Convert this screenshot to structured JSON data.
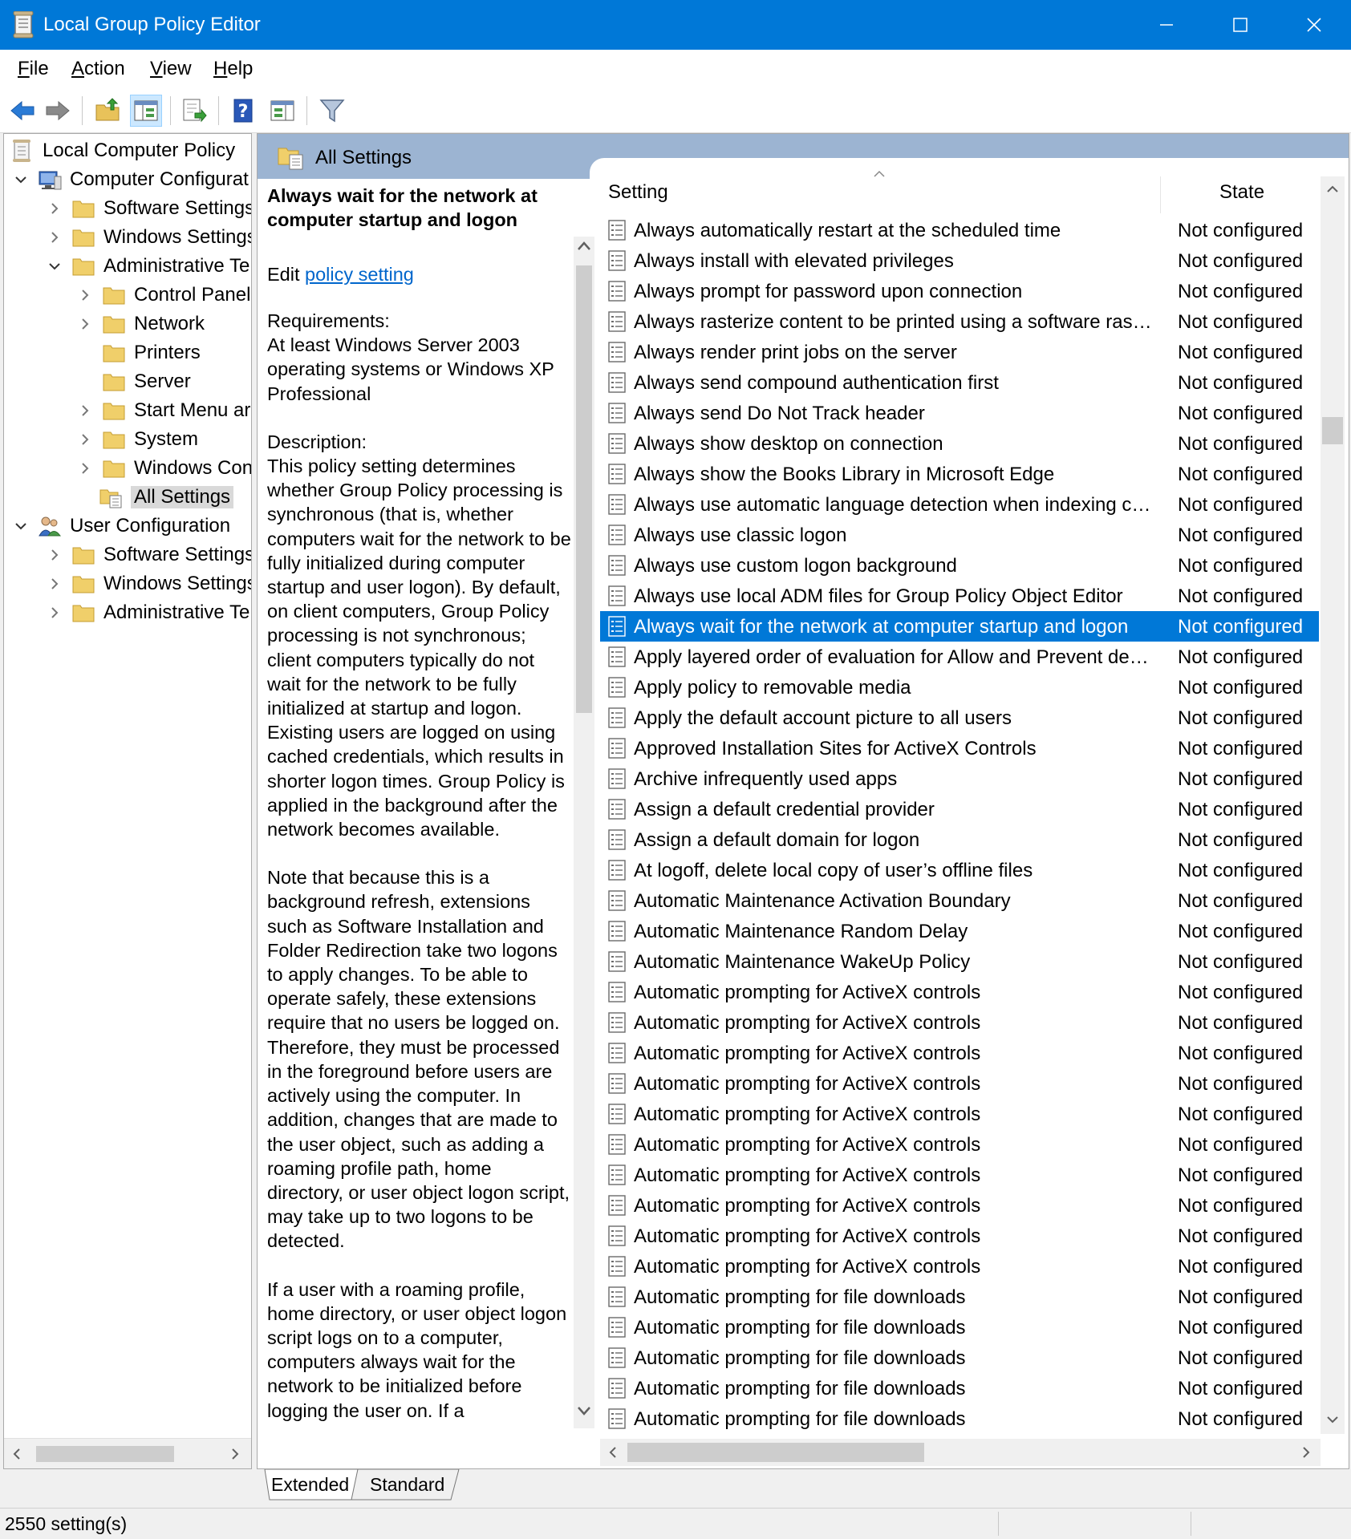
{
  "window": {
    "title": "Local Group Policy Editor"
  },
  "menu": {
    "file": {
      "u": "F",
      "rest": "ile"
    },
    "action": {
      "u": "A",
      "rest": "ction"
    },
    "view": {
      "u": "V",
      "rest": "iew"
    },
    "help": {
      "u": "H",
      "rest": "elp"
    }
  },
  "tree": {
    "root": "Local Computer Policy",
    "computer_configuration": "Computer Configurat",
    "cc_software_settings": "Software Settings",
    "cc_windows_settings": "Windows Settings",
    "cc_administrative_templates": "Administrative Te",
    "control_panel": "Control Panel",
    "network": "Network",
    "printers": "Printers",
    "server": "Server",
    "start_menu": "Start Menu ar",
    "system": "System",
    "windows_components": "Windows Con",
    "all_settings": "All Settings",
    "user_configuration": "User Configuration",
    "uc_software_settings": "Software Settings",
    "uc_windows_settings": "Windows Settings",
    "uc_administrative_templates": "Administrative Te"
  },
  "header": {
    "title": "All Settings"
  },
  "description": {
    "title": "Always wait for the network at computer startup and logon",
    "edit_prefix": "Edit ",
    "edit_link": "policy setting ",
    "requirements_label": "Requirements:",
    "requirements_text": "At least Windows Server 2003 operating systems or Windows XP Professional",
    "description_label": "Description:",
    "paragraph1": "This policy setting determines whether Group Policy processing is synchronous (that is, whether computers wait for the network to be fully initialized during computer startup and user logon). By default, on client computers, Group Policy processing is not synchronous; client computers typically do not wait for the network to be fully initialized at startup and logon. Existing users are logged on using cached credentials, which results in shorter logon times. Group Policy is applied in the background after the network becomes available.",
    "paragraph2": "Note that because this is a background refresh, extensions such as Software Installation and Folder Redirection take two logons to apply changes. To be able to operate safely, these extensions require that no users be logged on. Therefore, they must be processed in the foreground before users are actively using the computer. In addition, changes that are made to the user object, such as adding a roaming profile path, home directory, or user object logon script, may take up to two logons to be detected.",
    "paragraph3": "If a user with a roaming profile, home directory, or user object logon script logs on to a computer, computers always wait for the network to be initialized before logging the user on. If a"
  },
  "table": {
    "col_setting": "Setting",
    "col_state": "State",
    "rows": [
      {
        "name": "Always automatically restart at the scheduled time",
        "state": "Not configured"
      },
      {
        "name": "Always install with elevated privileges",
        "state": "Not configured"
      },
      {
        "name": "Always prompt for password upon connection",
        "state": "Not configured"
      },
      {
        "name": "Always rasterize content to be printed using a software rasteri...",
        "state": "Not configured"
      },
      {
        "name": "Always render print jobs on the server",
        "state": "Not configured"
      },
      {
        "name": "Always send compound authentication first",
        "state": "Not configured"
      },
      {
        "name": "Always send Do Not Track header",
        "state": "Not configured"
      },
      {
        "name": "Always show desktop on connection",
        "state": "Not configured"
      },
      {
        "name": "Always show the Books Library in Microsoft Edge",
        "state": "Not configured"
      },
      {
        "name": "Always use automatic language detection when indexing con...",
        "state": "Not configured"
      },
      {
        "name": "Always use classic logon",
        "state": "Not configured"
      },
      {
        "name": "Always use custom logon background",
        "state": "Not configured"
      },
      {
        "name": "Always use local ADM files for Group Policy Object Editor",
        "state": "Not configured"
      },
      {
        "name": "Always wait for the network at computer startup and logon",
        "state": "Not configured",
        "selected": true
      },
      {
        "name": "Apply layered order of evaluation for Allow and Prevent devic...",
        "state": "Not configured"
      },
      {
        "name": "Apply policy to removable media",
        "state": "Not configured"
      },
      {
        "name": "Apply the default account picture to all users",
        "state": "Not configured"
      },
      {
        "name": "Approved Installation Sites for ActiveX Controls",
        "state": "Not configured"
      },
      {
        "name": "Archive infrequently used apps",
        "state": "Not configured"
      },
      {
        "name": "Assign a default credential provider",
        "state": "Not configured"
      },
      {
        "name": "Assign a default domain for logon",
        "state": "Not configured"
      },
      {
        "name": "At logoff, delete local copy of user’s offline files",
        "state": "Not configured"
      },
      {
        "name": "Automatic Maintenance Activation Boundary",
        "state": "Not configured"
      },
      {
        "name": "Automatic Maintenance Random Delay",
        "state": "Not configured"
      },
      {
        "name": "Automatic Maintenance WakeUp Policy",
        "state": "Not configured"
      },
      {
        "name": "Automatic prompting for ActiveX controls",
        "state": "Not configured"
      },
      {
        "name": "Automatic prompting for ActiveX controls",
        "state": "Not configured"
      },
      {
        "name": "Automatic prompting for ActiveX controls",
        "state": "Not configured"
      },
      {
        "name": "Automatic prompting for ActiveX controls",
        "state": "Not configured"
      },
      {
        "name": "Automatic prompting for ActiveX controls",
        "state": "Not configured"
      },
      {
        "name": "Automatic prompting for ActiveX controls",
        "state": "Not configured"
      },
      {
        "name": "Automatic prompting for ActiveX controls",
        "state": "Not configured"
      },
      {
        "name": "Automatic prompting for ActiveX controls",
        "state": "Not configured"
      },
      {
        "name": "Automatic prompting for ActiveX controls",
        "state": "Not configured"
      },
      {
        "name": "Automatic prompting for ActiveX controls",
        "state": "Not configured"
      },
      {
        "name": "Automatic prompting for file downloads",
        "state": "Not configured"
      },
      {
        "name": "Automatic prompting for file downloads",
        "state": "Not configured"
      },
      {
        "name": "Automatic prompting for file downloads",
        "state": "Not configured"
      },
      {
        "name": "Automatic prompting for file downloads",
        "state": "Not configured"
      },
      {
        "name": "Automatic prompting for file downloads",
        "state": "Not configured"
      }
    ]
  },
  "tabs": {
    "extended": "Extended",
    "standard": "Standard"
  },
  "status": {
    "text": "2550 setting(s)"
  }
}
